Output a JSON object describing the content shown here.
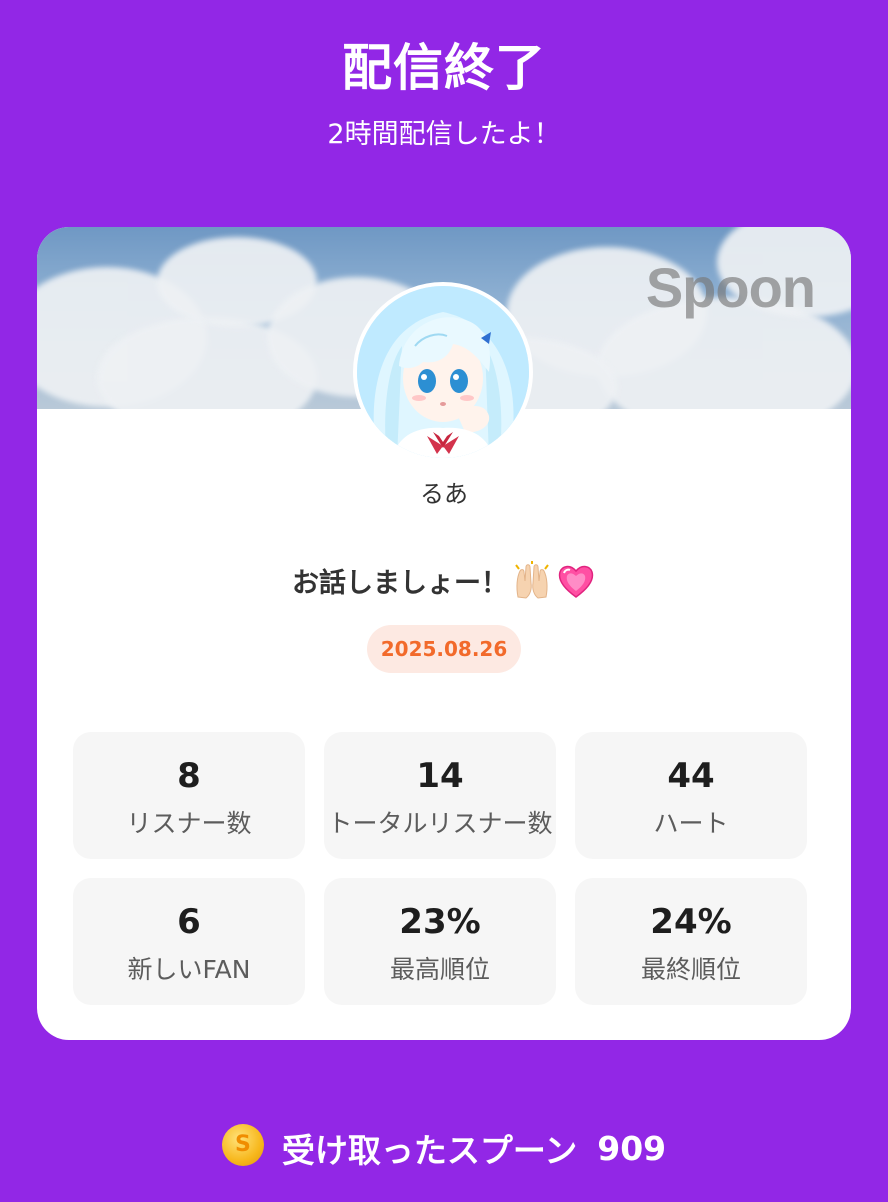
{
  "header": {
    "title": "配信終了",
    "subtitle": "2時間配信したよ！"
  },
  "card": {
    "brand": "Spoon",
    "username": "るあ",
    "room_title": "お話しましょー！",
    "room_title_emojis": [
      "raising-hands-emoji",
      "heart-emoji"
    ],
    "date": "2025.08.26"
  },
  "stats": [
    {
      "value": "8",
      "label": "リスナー数"
    },
    {
      "value": "14",
      "label": "トータルリスナー数"
    },
    {
      "value": "44",
      "label": "ハート"
    },
    {
      "value": "6",
      "label": "新しいFAN"
    },
    {
      "value": "23%",
      "label": "最高順位"
    },
    {
      "value": "24%",
      "label": "最終順位"
    }
  ],
  "footer": {
    "coin_symbol": "S",
    "label": "受け取ったスプーン",
    "value": "909"
  },
  "colors": {
    "background": "#9227e6",
    "date_badge_text": "#f26a2b",
    "date_badge_bg": "#fde9e2"
  }
}
